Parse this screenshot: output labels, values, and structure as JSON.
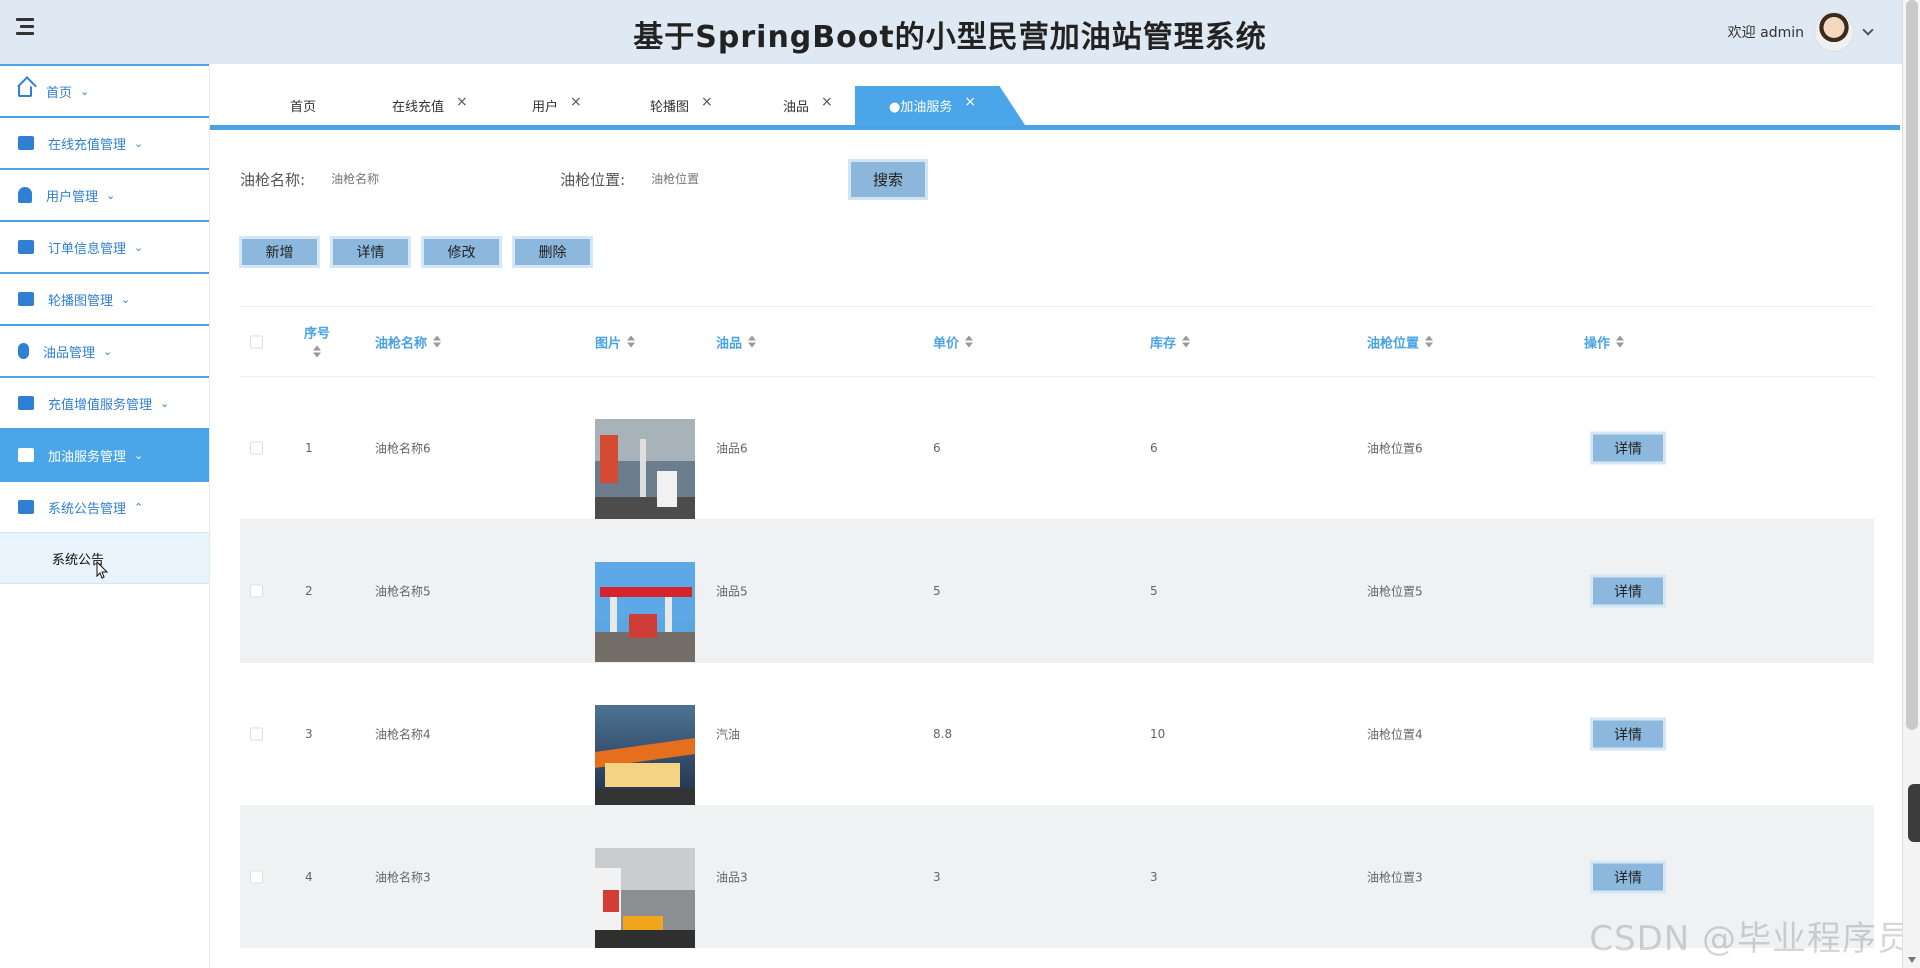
{
  "header": {
    "title": "基于SpringBoot的小型民营加油站管理系统",
    "user_label": "欢迎 admin"
  },
  "sidebar": {
    "items": [
      {
        "label": "首页",
        "icon": "home-icon"
      },
      {
        "label": "在线充值管理",
        "icon": "briefcase-icon"
      },
      {
        "label": "用户管理",
        "icon": "user-icon"
      },
      {
        "label": "订单信息管理",
        "icon": "book-icon"
      },
      {
        "label": "轮播图管理",
        "icon": "wallet-icon"
      },
      {
        "label": "油品管理",
        "icon": "mouse-icon"
      },
      {
        "label": "充值增值服务管理",
        "icon": "columns-icon"
      },
      {
        "label": "加油服务管理",
        "icon": "toolbox-icon",
        "active": true
      },
      {
        "label": "系统公告管理",
        "icon": "car-icon",
        "expanded": true
      }
    ],
    "sub_items": [
      "系统公告"
    ]
  },
  "tabs": [
    {
      "label": "首页"
    },
    {
      "label": "在线充值",
      "close": "×"
    },
    {
      "label": "用户",
      "close": "×"
    },
    {
      "label": "轮播图",
      "close": "×"
    },
    {
      "label": "油品",
      "close": "×"
    },
    {
      "label": "●加油服务",
      "close": "×",
      "active": true
    }
  ],
  "search": {
    "gun_name_label": "油枪名称:",
    "gun_name_placeholder": "油枪名称",
    "gun_location_label": "油枪位置:",
    "gun_location_placeholder": "油枪位置",
    "button": "搜索"
  },
  "actions": {
    "add": "新增",
    "detail": "详情",
    "edit": "修改",
    "delete": "删除"
  },
  "table": {
    "headers": [
      "序号",
      "油枪名称",
      "图片",
      "油品",
      "单价",
      "库存",
      "油枪位置",
      "操作"
    ],
    "rows": [
      {
        "index": "1",
        "gun_name": "油枪名称6",
        "oil": "油品6",
        "price": "6",
        "stock": "6",
        "location": "油枪位置6",
        "action": "详情"
      },
      {
        "index": "2",
        "gun_name": "油枪名称5",
        "oil": "油品5",
        "price": "5",
        "stock": "5",
        "location": "油枪位置5",
        "action": "详情"
      },
      {
        "index": "3",
        "gun_name": "油枪名称4",
        "oil": "汽油",
        "price": "8.8",
        "stock": "10",
        "location": "油枪位置4",
        "action": "详情"
      },
      {
        "index": "4",
        "gun_name": "油枪名称3",
        "oil": "油品3",
        "price": "3",
        "stock": "3",
        "location": "油枪位置3",
        "action": "详情"
      }
    ]
  },
  "watermark": "CSDN @毕业程序员",
  "colors": {
    "header_bg": "#dfe9f3",
    "accent": "#4aa6e8",
    "button": "#8bb8dc",
    "row_alt": "#f0f1f3"
  }
}
